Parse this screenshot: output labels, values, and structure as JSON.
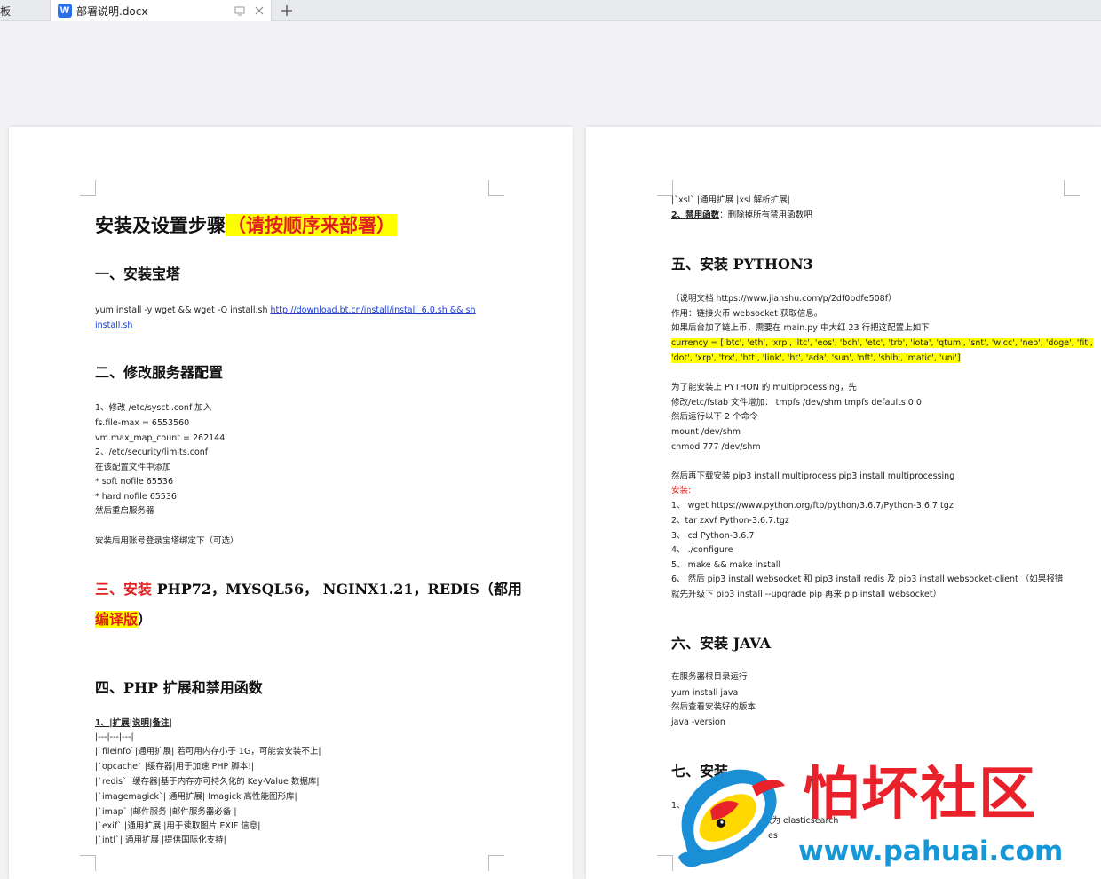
{
  "tabs": {
    "prev_label": "板",
    "active_label": "部署说明.docx",
    "doc_icon_letter": "W"
  },
  "left": {
    "title_main": "安装及设置步骤",
    "title_hl": "（请按顺序来部署）",
    "s1_heading": "一、安装宝塔",
    "s1_cmd": "yum  install  -y  wget  &&  wget  -O  install.sh  ",
    "s1_link_a": "http://download.bt.cn/install/install_6.0.sh  &&  sh",
    "s1_link_b": "install.sh",
    "s2_heading": "二、修改服务器配置",
    "s2_lines": [
      "1、修改  /etc/sysctl.conf 加入",
      "fs.file-max = 6553560",
      "vm.max_map_count = 262144",
      "2、/etc/security/limits.conf",
      "在该配置文件中添加",
      "* soft nofile 65536",
      "* hard nofile 65536",
      "然后重启服务器"
    ],
    "s2_note": "安装后用账号登录宝塔绑定下（可选）",
    "s3_red": "三、安装",
    "s3_rest": " PHP72，MYSQL56，  NGINX1.21，REDIS（都用",
    "s3_hl": "编译版",
    "s3_end": "）",
    "s4_heading": "四、PHP 扩展和禁用函数",
    "s4_sub": "1、|扩展|说明|备注|",
    "s4_lines": [
      "|---|---|---|",
      "|`fileinfo`|通用扩展|    若可用内存小于 1G，可能会安装不上|",
      "|`opcache`      |缓存器|用于加速 PHP 脚本!|",
      "|`redis`    |缓存器|基于内存亦可持久化的 Key-Value 数据库|",
      "|`imagemagick`|      通用扩展|      Imagick 高性能图形库|",
      "|`imap`    |邮件服务      |邮件服务器必备         |",
      "|`exif`      |通用扩展      |用于读取图片 EXIF 信息|",
      "|`intl`|      通用扩展      |提供国际化支持|"
    ]
  },
  "right": {
    "top_line": "|`xsl`      |通用扩展      |xsl 解析扩展|",
    "disable_label": "2、禁用函数",
    "disable_text": "：删除掉所有禁用函数吧",
    "s5_heading": "五、安装 PYTHON3",
    "s5_lines": [
      " （说明文档 https://www.jianshu.com/p/2df0bdfe508f）",
      "作用：链接火币 websocket 获取信息。",
      "如果后台加了链上币，需要在 main.py 中大红 23 行把这配置上如下"
    ],
    "currency_1": "currency = ['btc', 'eth', 'xrp', 'ltc', 'eos', 'bch', 'etc', 'trb', 'iota', 'qtum', 'snt', 'wicc', 'neo', 'doge', 'fit',",
    "currency_2": "'dot', 'xrp', 'trx', 'btt', 'link', 'ht', 'ada', 'sun', 'nft', 'shib', 'matic', 'uni']",
    "mp_lines": [
      "为了能安装上 PYTHON 的 multiprocessing，先",
      "修改/etc/fstab 文件增加：  tmpfs /dev/shm tmpfs defaults 0 0",
      "然后运行以下 2 个命令",
      "mount /dev/shm",
      "chmod 777 /dev/shm"
    ],
    "pip_line": "然后再下载安装   pip3 install multiprocess      pip3 install multiprocessing",
    "install_label": "安装:",
    "install_lines": [
      "1、  wget https://www.python.org/ftp/python/3.6.7/Python-3.6.7.tgz",
      "2、tar zxvf Python-3.6.7.tgz",
      "3、  cd Python-3.6.7",
      "4、  ./configure",
      "5、  make && make install",
      "6、  然后   pip3 install websocket 和 pip3 install redis 及 pip3 install websocket-client   （如果报错",
      "就先升级下 pip3 install --upgrade pip 再来 pip install websocket）"
    ],
    "s6_heading": "六、安装 JAVA",
    "java_lines": [
      "在服务器根目录运行",
      "yum install java",
      "然后查看安装好的版本",
      "java -version"
    ],
    "s7_heading": "七、安装",
    "s7_frag_1": "1、",
    "s7_frag_2": "大为 elasticsearch",
    "s7_frag_3": "es"
  },
  "watermark": {
    "title": "怕坏社区",
    "url": "www.pahuai.com"
  }
}
